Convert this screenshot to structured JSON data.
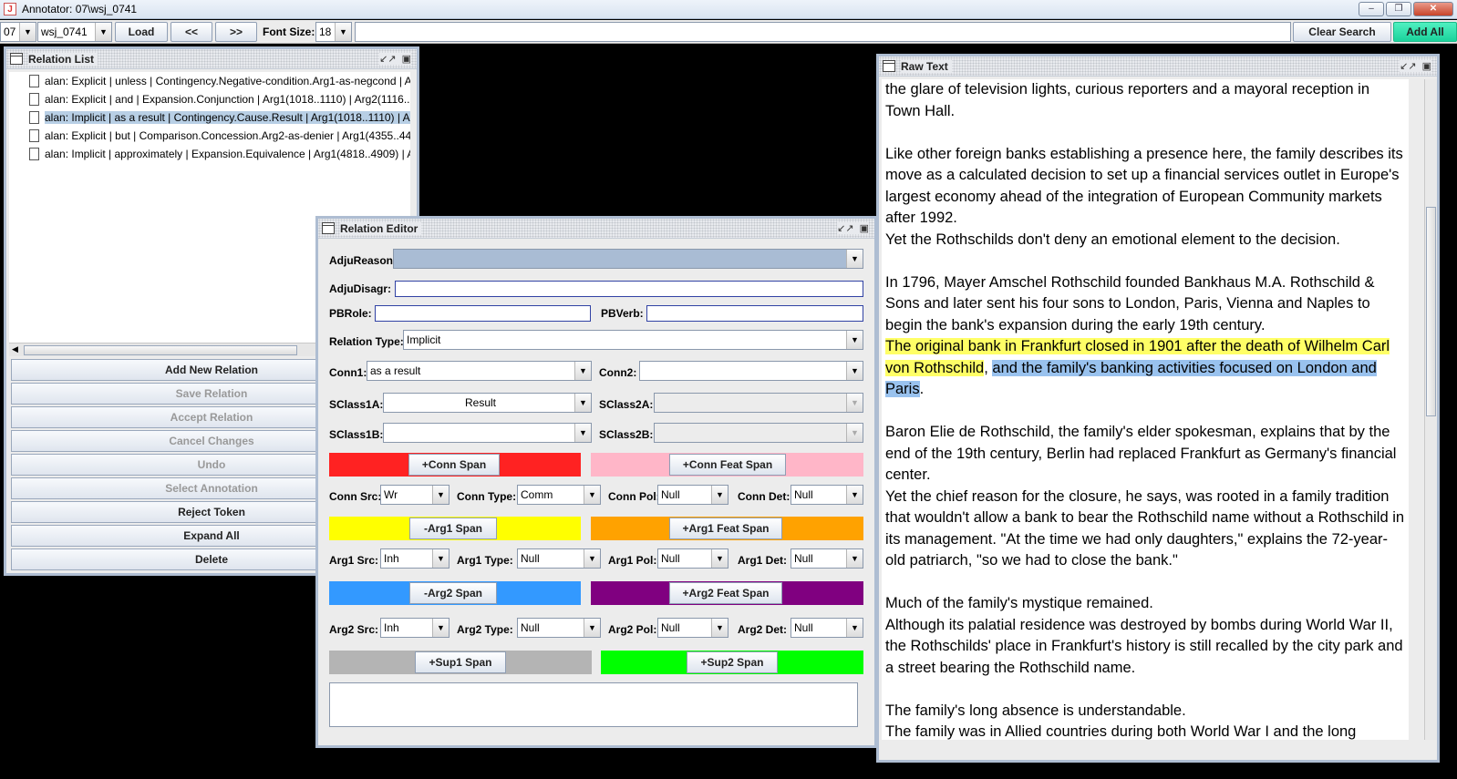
{
  "window": {
    "title": "Annotator:  07\\wsj_0741",
    "min": "–",
    "max": "❐",
    "close": "✕"
  },
  "toolbar": {
    "section": "07",
    "file": "wsj_0741",
    "load": "Load",
    "prev": "<<",
    "next": ">>",
    "font_size_label": "Font Size:",
    "font_size": "18",
    "clear_search": "Clear Search",
    "add_all": "Add All"
  },
  "relation_list": {
    "title": "Relation List",
    "items": [
      "alan: Explicit | unless | Contingency.Negative-condition.Arg1-as-negcond | A",
      "alan: Explicit | and | Expansion.Conjunction | Arg1(1018..1110) | Arg2(1116..",
      "alan: Implicit | as a result | Contingency.Cause.Result | Arg1(1018..1110) | A",
      "alan: Explicit | but | Comparison.Concession.Arg2-as-denier | Arg1(4355..44",
      "alan: Implicit | approximately | Expansion.Equivalence | Arg1(4818..4909) | A"
    ],
    "buttons": {
      "add_new": "Add New Relation",
      "save": "Save Relation",
      "accept": "Accept Relation",
      "cancel": "Cancel Changes",
      "undo": "Undo",
      "select_annotation": "Select Annotation",
      "reject_token": "Reject Token",
      "expand_all": "Expand All",
      "delete": "Delete"
    }
  },
  "editor": {
    "title": "Relation Editor",
    "adju_reason_label": "AdjuReason",
    "adju_disagr_label": "AdjuDisagr:",
    "pbrole_label": "PBRole:",
    "pbverb_label": "PBVerb:",
    "relation_type_label": "Relation Type:",
    "relation_type": "Implicit",
    "conn1_label": "Conn1:",
    "conn1": "as a result",
    "conn2_label": "Conn2:",
    "sclass1a_label": "SClass1A:",
    "sclass1a": "Result",
    "sclass2a_label": "SClass2A:",
    "sclass1b_label": "SClass1B:",
    "sclass2b_label": "SClass2B:",
    "conn_span": "+Conn Span",
    "conn_feat_span": "+Conn Feat Span",
    "conn_src_label": "Conn Src:",
    "conn_src": "Wr",
    "conn_type_label": "Conn Type:",
    "conn_type": "Comm",
    "conn_pol_label": "Conn Pol:",
    "conn_pol": "Null",
    "conn_det_label": "Conn Det:",
    "conn_det": "Null",
    "arg1_span": "-Arg1 Span",
    "arg1_feat_span": "+Arg1 Feat Span",
    "arg1_src_label": "Arg1 Src:",
    "arg1_src": "Inh",
    "arg1_type_label": "Arg1 Type:",
    "arg1_type": "Null",
    "arg1_pol_label": "Arg1 Pol:",
    "arg1_pol": "Null",
    "arg1_det_label": "Arg1 Det:",
    "arg1_det": "Null",
    "arg2_span": "-Arg2 Span",
    "arg2_feat_span": "+Arg2 Feat Span",
    "arg2_src_label": "Arg2 Src:",
    "arg2_src": "Inh",
    "arg2_type_label": "Arg2 Type:",
    "arg2_type": "Null",
    "arg2_pol_label": "Arg2 Pol:",
    "arg2_pol": "Null",
    "arg2_det_label": "Arg2 Det:",
    "arg2_det": "Null",
    "sup1_span": "+Sup1 Span",
    "sup2_span": "+Sup2 Span",
    "colors": {
      "conn": "#ff2222",
      "conn_feat": "#ffb6c8",
      "arg1": "#ffff00",
      "arg1_feat": "#ffa200",
      "arg2": "#3399ff",
      "arg2_feat": "#800080",
      "sup1": "#b4b4b4",
      "sup2": "#00ff00"
    }
  },
  "raw_text": {
    "title": "Raw Text",
    "p1": "the glare of television lights, curious reporters and a mayoral reception in Town Hall.",
    "p2": "Like other foreign banks establishing a presence here, the family describes its move as a calculated decision to set up a financial services outlet in Europe's largest economy ahead of the integration of European Community markets after 1992.",
    "p2b": "Yet the Rothschilds don't deny an emotional element to the decision.",
    "p3": "In 1796, Mayer Amschel Rothschild founded Bankhaus M.A. Rothschild & Sons and later sent his four sons to London, Paris, Vienna and Naples to begin the bank's expansion during the early 19th century.",
    "p3_arg1": "The original bank in Frankfurt closed in 1901 after the death of Wilhelm Carl von Rothschild",
    "p3_mid": ", ",
    "p3_arg2": "and the family's banking activities focused on London and Paris",
    "p3_end": ".",
    "p4": "Baron Elie de Rothschild, the family's elder spokesman, explains that by the end of the 19th century, Berlin had replaced Frankfurt as Germany's financial center.",
    "p4b": "Yet the chief reason for the closure, he says, was rooted in a family tradition that wouldn't allow a bank to bear the Rothschild name without a Rothschild in its management. \"At the time we had only daughters,\" explains the 72-year-old patriarch, \"so we had to close the bank.\"",
    "p5": "Much of the family's mystique remained.",
    "p5b": "Although its palatial residence was destroyed by bombs during World War II, the Rothschilds' place in Frankfurt's history is still recalled by the city park and a street bearing the Rothschild name.",
    "p6": "The family's long absence is understandable.",
    "p6b": "The family was in Allied countries during both World War I and the long"
  }
}
